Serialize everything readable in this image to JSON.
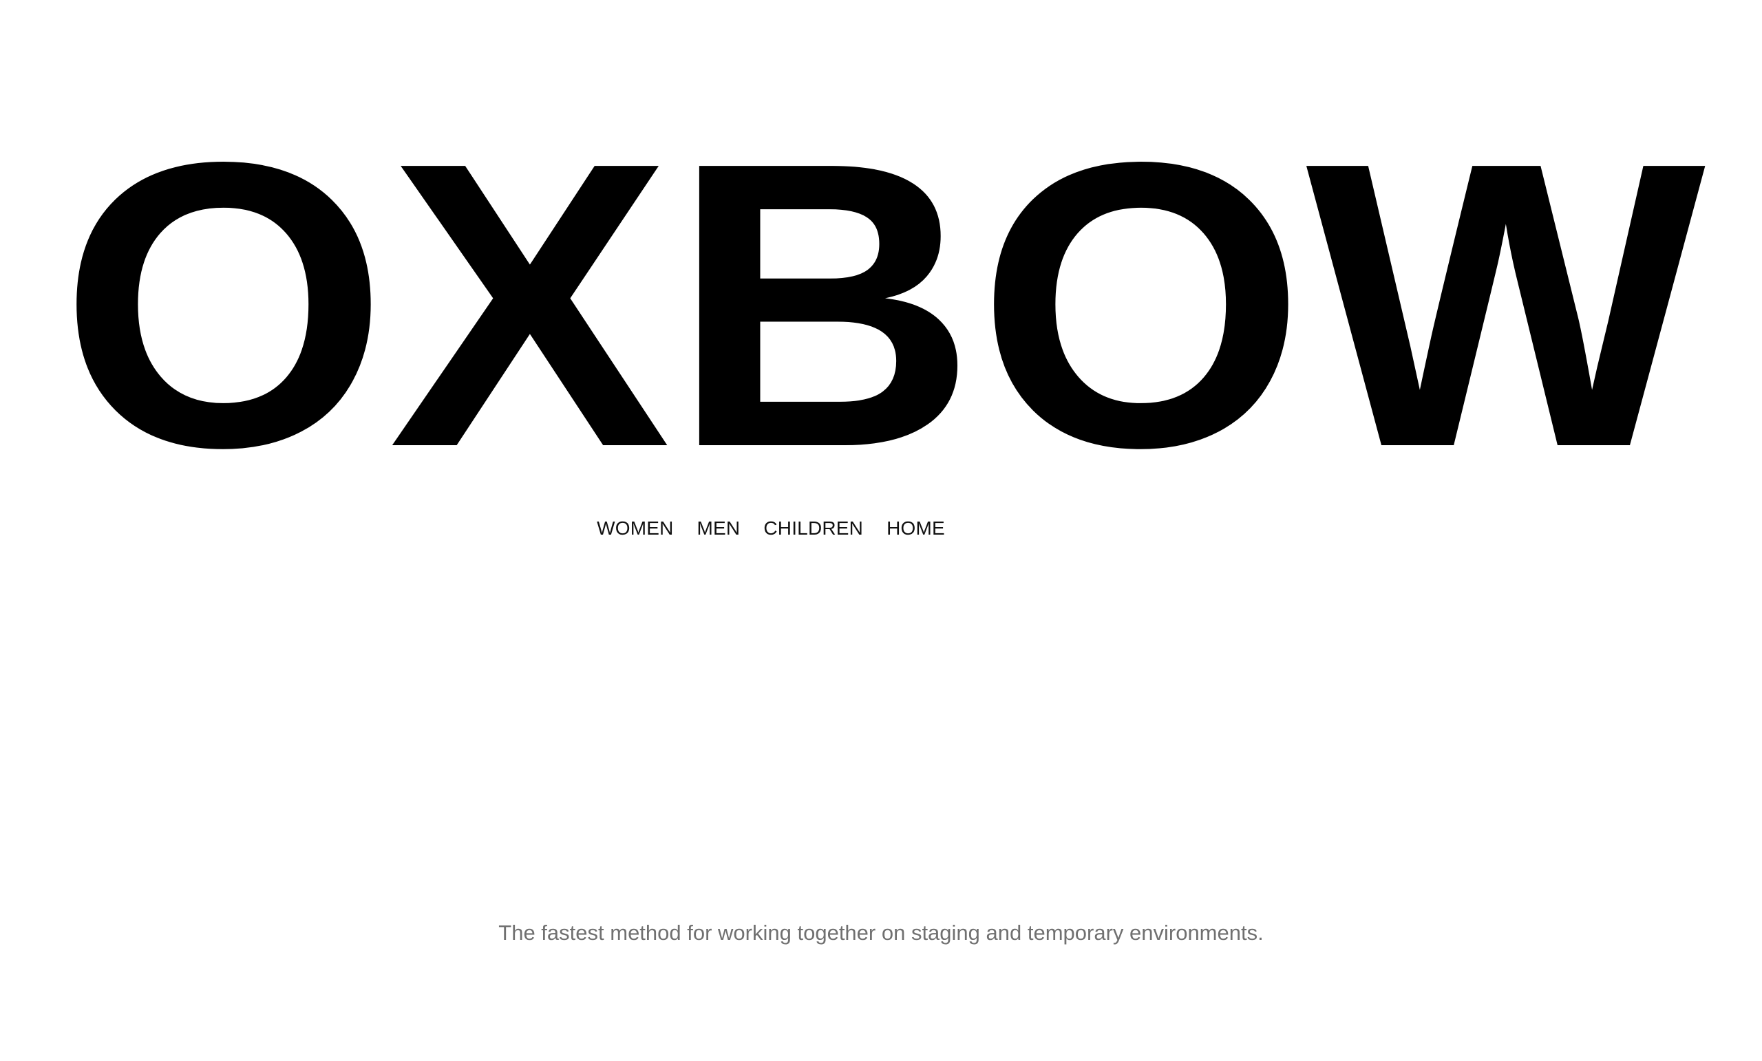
{
  "brand": {
    "logo_text": "OXBOW"
  },
  "nav": {
    "items": [
      {
        "label": "WOMEN"
      },
      {
        "label": "MEN"
      },
      {
        "label": "CHILDREN"
      },
      {
        "label": "HOME"
      }
    ]
  },
  "hero": {
    "tagline": "The fastest method for working together on staging and temporary environments."
  },
  "colors": {
    "background": "#ffffff",
    "logo": "#000000",
    "nav_text": "#111111",
    "tagline_text": "#707070"
  }
}
